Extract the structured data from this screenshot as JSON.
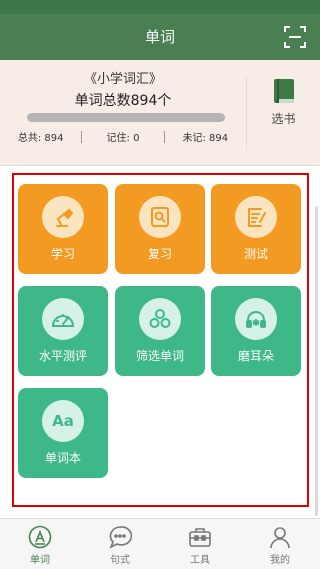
{
  "header": {
    "title": "单词"
  },
  "book": {
    "name": "《小学词汇》",
    "total_label": "单词总数894个",
    "progress": 0,
    "stats": [
      {
        "label": "总共: 894"
      },
      {
        "label": "记住: 0"
      },
      {
        "label": "未记: 894"
      }
    ],
    "select_label": "选书"
  },
  "tiles": [
    {
      "label": "学习",
      "icon": "desk-lamp-icon",
      "color": "#f39a22"
    },
    {
      "label": "复习",
      "icon": "magnifier-doc-icon",
      "color": "#f39a22"
    },
    {
      "label": "测试",
      "icon": "checklist-icon",
      "color": "#f39a22"
    },
    {
      "label": "水平测评",
      "icon": "gauge-icon",
      "color": "#3fb889"
    },
    {
      "label": "筛选单词",
      "icon": "three-circles-icon",
      "color": "#3fb889"
    },
    {
      "label": "磨耳朵",
      "icon": "headphones-icon",
      "color": "#3fb889"
    },
    {
      "label": "单词本",
      "icon": "aa-text-icon",
      "color": "#3fb889",
      "icon_text": "Aa"
    }
  ],
  "tabbar": [
    {
      "label": "单词",
      "icon": "letter-a-icon",
      "active": true
    },
    {
      "label": "句式",
      "icon": "chat-bubble-icon",
      "active": false
    },
    {
      "label": "工具",
      "icon": "toolbox-icon",
      "active": false
    },
    {
      "label": "我的",
      "icon": "person-icon",
      "active": false
    }
  ]
}
